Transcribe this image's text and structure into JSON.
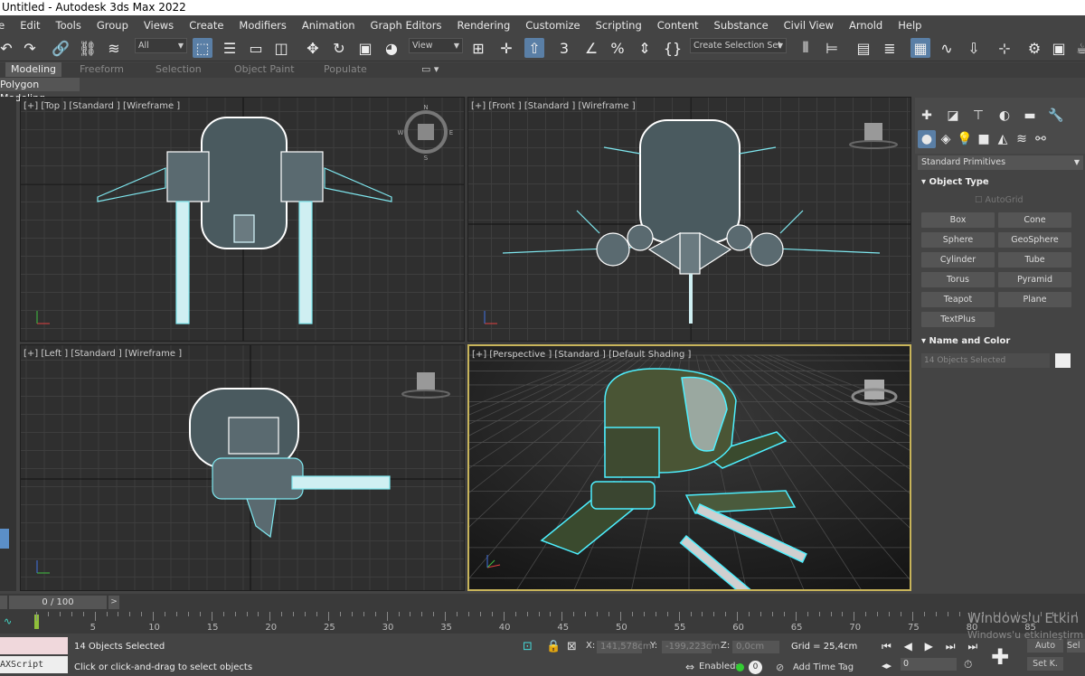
{
  "window": {
    "title": "Untitled - Autodesk 3ds Max 2022"
  },
  "menu": [
    "File",
    "Edit",
    "Tools",
    "Group",
    "Views",
    "Create",
    "Modifiers",
    "Animation",
    "Graph Editors",
    "Rendering",
    "Customize",
    "Scripting",
    "Content",
    "Substance",
    "Civil View",
    "Arnold",
    "Help"
  ],
  "toolbar": {
    "filter": "All",
    "view": "View",
    "selection_set": "Create Selection Set"
  },
  "ribbon": {
    "tabs": [
      "Modeling",
      "Freeform",
      "Selection",
      "Object Paint",
      "Populate"
    ],
    "active": "Modeling",
    "sub": "Polygon Modeling"
  },
  "viewports": [
    {
      "label": "[+] [Top ] [Standard ] [Wireframe ]"
    },
    {
      "label": "[+] [Front ] [Standard ] [Wireframe ]"
    },
    {
      "label": "[+] [Left ] [Standard ] [Wireframe ]"
    },
    {
      "label": "[+] [Perspective ] [Standard ] [Default Shading ]"
    }
  ],
  "command_panel": {
    "category": "Standard Primitives",
    "object_type_title": "Object Type",
    "autogrid": "AutoGrid",
    "buttons": [
      "Box",
      "Cone",
      "Sphere",
      "GeoSphere",
      "Cylinder",
      "Tube",
      "Torus",
      "Pyramid",
      "Teapot",
      "Plane",
      "TextPlus"
    ],
    "name_color_title": "Name and Color",
    "selection_name": "14 Objects Selected"
  },
  "timeline": {
    "frame": "0 / 100",
    "ticks": [
      "5",
      "10",
      "15",
      "20",
      "25",
      "30",
      "35",
      "40",
      "45",
      "50",
      "55",
      "60",
      "65",
      "70",
      "75",
      "80",
      "85"
    ]
  },
  "status": {
    "maxscript": "AXScript Mini",
    "selected": "14 Objects Selected",
    "prompt": "Click or click-and-drag to select objects",
    "x_label": "X:",
    "x": "141,578cm",
    "y_label": "Y:",
    "y": "-199,223cm",
    "z_label": "Z:",
    "z": "0,0cm",
    "grid": "Grid = 25,4cm",
    "enabled": "Enabled:",
    "add_time_tag": "Add Time Tag",
    "auto": "Auto",
    "setk": "Set K.",
    "sel": "Sel",
    "frame_field": "0",
    "watermark1": "Windows'u Etkin",
    "watermark2": "Windows'u etkinleştirm"
  }
}
